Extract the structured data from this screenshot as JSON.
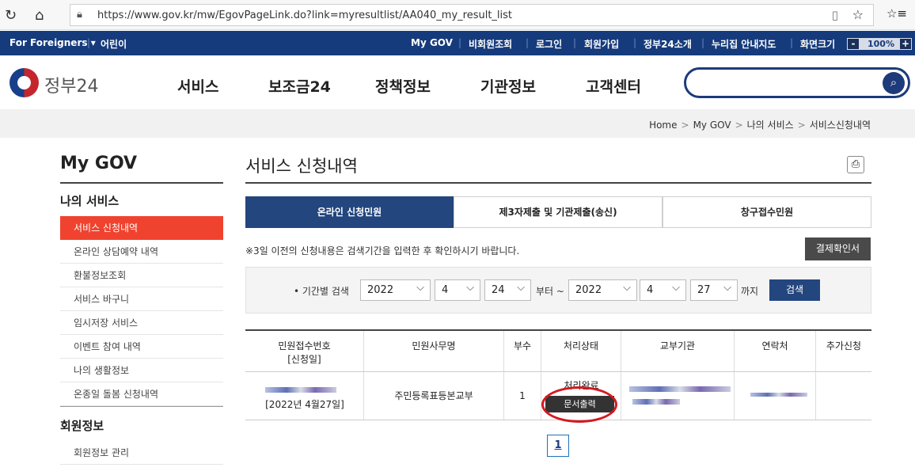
{
  "browser": {
    "url": "https://www.gov.kr/mw/EgovPageLink.do?link=myresultlist/AA040_my_result_list",
    "icons": [
      "refresh-icon",
      "home-icon",
      "lock-icon",
      "reading-view-icon",
      "favorite-star-icon",
      "favorites-list-icon"
    ]
  },
  "util": {
    "for_foreigners": "For Foreigners",
    "kids": "어린이",
    "links": [
      "My GOV",
      "비회원조회",
      "로그인",
      "회원가입",
      "정부24소개",
      "누리집 안내지도",
      "화면크기"
    ],
    "zoom": "100%",
    "zoom_minus": "-",
    "zoom_plus": "+"
  },
  "header": {
    "logo_text": "정부24",
    "gnb": [
      "서비스",
      "보조금24",
      "정책정보",
      "기관정보",
      "고객센터"
    ],
    "search_placeholder": ""
  },
  "breadcrumb": [
    "Home",
    "My GOV",
    "나의 서비스",
    "서비스신청내역"
  ],
  "sidebar": {
    "title": "My GOV",
    "section1": "나의 서비스",
    "items1": [
      "서비스 신청내역",
      "온라인 상담예약 내역",
      "환불정보조회",
      "서비스 바구니",
      "임시저장 서비스",
      "이벤트 참여 내역",
      "나의 생활정보",
      "온종일 돌봄 신청내역"
    ],
    "section2": "회원정보",
    "items2": [
      "회원정보 관리"
    ]
  },
  "main": {
    "title": "서비스 신청내역",
    "tabs": [
      "온라인 신청민원",
      "제3자제출 및 기관제출(송신)",
      "창구접수민원"
    ],
    "notice": "※3일 이전의 신청내용은 검색기간을 입력한 후 확인하시기 바랍니다.",
    "pay_button": "결제확인서",
    "filter": {
      "label": "• 기간별 검색",
      "from_year": "2022",
      "from_month": "4",
      "from_day": "24",
      "range_text": "부터 ~",
      "to_year": "2022",
      "to_month": "4",
      "to_day": "27",
      "until_text": "까지",
      "search_button": "검색"
    },
    "table": {
      "headers": [
        "민원접수번호\n[신청일]",
        "민원사무명",
        "부수",
        "처리상태",
        "교부기관",
        "연락처",
        "추가신청"
      ],
      "rows": [
        {
          "date": "[2022년 4월27일]",
          "service": "주민등록표등본교부",
          "copies": "1",
          "status": "처리완료",
          "action": "문서출력",
          "extra": ""
        }
      ]
    },
    "pagination": [
      "1"
    ]
  }
}
